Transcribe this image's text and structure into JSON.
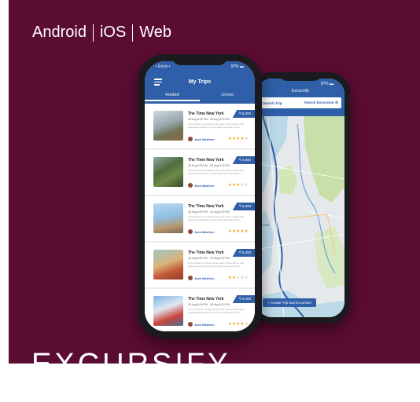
{
  "platforms": [
    "Android",
    "iOS",
    "Web"
  ],
  "title": "EXCURSIFY",
  "list_phone": {
    "status_left": "• Excsi •",
    "status_right": "97% ▬",
    "title": "My Trips",
    "tabs": [
      "Hosted",
      "Joined"
    ],
    "trips": [
      {
        "title": "The Time New York",
        "date": "28 Aug 8:00 PM - 28 Aug 8:30 PM",
        "desc": "Lorem Ipsum is simply dummy text of the printing and typesetting industry. Lorem Ipsum has been the in...",
        "price": "₹ 6,000",
        "host": "Jack Marthen",
        "stars_on": "★★★★",
        "stars_off": "★"
      },
      {
        "title": "The Time New York",
        "date": "28 Aug 8:00 PM - 28 Aug 8:30 PM",
        "desc": "Lorem Ipsum is simply dummy text of the printing and typesetting industry. Lorem Ipsum has been the in...",
        "price": "₹ 6,000",
        "host": "Jack Marthen",
        "stars_on": "★★★",
        "stars_off": "★★"
      },
      {
        "title": "The Time New York",
        "date": "28 Aug 8:00 PM - 28 Aug 8:30 PM",
        "desc": "Lorem Ipsum is simply dummy text of the printing and typesetting industry. Lorem Ipsum has been the in...",
        "price": "₹ 6,000",
        "host": "Jack Marthen",
        "stars_on": "★★★★★",
        "stars_off": ""
      },
      {
        "title": "The Time New York",
        "date": "28 Aug 8:00 PM - 28 Aug 8:30 PM",
        "desc": "Lorem Ipsum is simply dummy text of the printing and typesetting industry. Lorem Ipsum has been the in...",
        "price": "₹ 6,000",
        "host": "Jack Marthen",
        "stars_on": "★★",
        "stars_off": "★★★"
      },
      {
        "title": "The Time New York",
        "date": "28 Aug 8:00 PM - 28 Aug 8:30 PM",
        "desc": "Lorem Ipsum is simply dummy text of the printing and typesetting industry. Lorem Ipsum has been the in...",
        "price": "₹ 6,000",
        "host": "Jack Marthen",
        "stars_on": "★★★★",
        "stars_off": "★"
      }
    ]
  },
  "map_phone": {
    "status_right": "97% ▬",
    "title": "Excursify",
    "search_trip": "Search Trip",
    "search_excursion": "Search Excursion",
    "map_label": "SROOK",
    "create_button": "+ Create Trip and Excursion"
  },
  "colors": {
    "background": "#5b0c33",
    "accent": "#2f5fa8",
    "star": "#f2a71b"
  }
}
